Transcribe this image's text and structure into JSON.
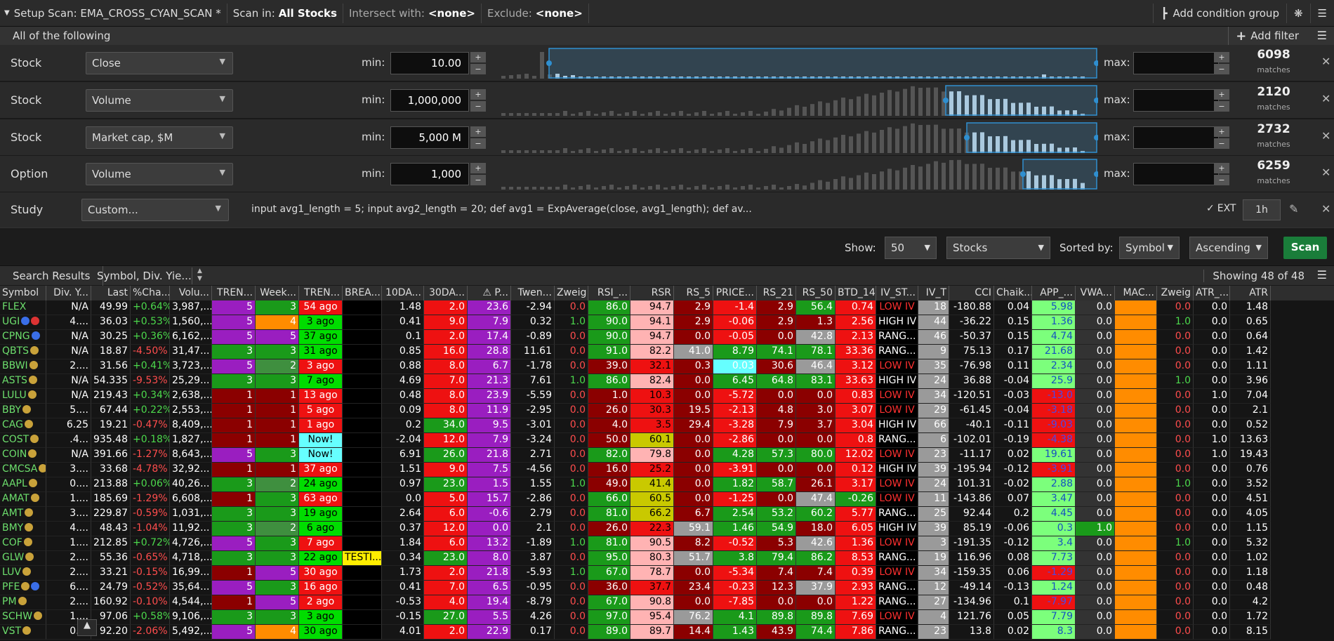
{
  "topbar": {
    "setup_scan": "Setup Scan: EMA_CROSS_CYAN_SCAN *",
    "scan_in_label": "Scan in:",
    "scan_in_value": "All Stocks",
    "intersect_label": "Intersect with:",
    "intersect_value": "<none>",
    "exclude_label": "Exclude:",
    "exclude_value": "<none>",
    "add_condition_group": "Add condition group"
  },
  "criteria": {
    "title": "All of the following",
    "add_filter": "Add filter"
  },
  "filters": [
    {
      "label": "Stock",
      "field": "Close",
      "min_label": "min:",
      "min": "10.00",
      "max_label": "max:",
      "max": "",
      "matches": "6098",
      "matches_label": "matches"
    },
    {
      "label": "Stock",
      "field": "Volume",
      "min_label": "min:",
      "min": "1,000,000",
      "max_label": "max:",
      "max": "",
      "matches": "2120",
      "matches_label": "matches"
    },
    {
      "label": "Stock",
      "field": "Market cap, $M",
      "min_label": "min:",
      "min": "5,000 M",
      "max_label": "max:",
      "max": "",
      "matches": "2732",
      "matches_label": "matches"
    },
    {
      "label": "Option",
      "field": "Volume",
      "min_label": "min:",
      "min": "1,000",
      "max_label": "max:",
      "max": "",
      "matches": "6259",
      "matches_label": "matches"
    }
  ],
  "study": {
    "label": "Study",
    "field": "Custom...",
    "code": "input avg1_length = 5; input avg2_length = 20;  def avg1 = ExpAverage(close, avg1_length); def av...",
    "ext": "EXT",
    "timeframe": "1h"
  },
  "show": {
    "label": "Show:",
    "count": "50",
    "type": "Stocks",
    "sorted_label": "Sorted by:",
    "sorted_field": "Symbol",
    "order": "Ascending",
    "scan": "Scan"
  },
  "results": {
    "tab": "Search Results",
    "sort_cols": "Symbol, Div. Yie...",
    "showing": "Showing 48 of 48"
  },
  "colors": {
    "green": "#00dd00",
    "red": "#ee1111",
    "purple": "#9a1ec0",
    "darkred": "#8b0000",
    "cyan": "#66ffff",
    "orange": "#ff8c00",
    "yellow": "#ffee00",
    "grey": "#9a9a9a",
    "pink": "#ffb3b3",
    "lime": "#7cff7c"
  },
  "table": {
    "headers": [
      "Symbol",
      "Div. Y...",
      "Last",
      "%Cha...",
      "Volu...",
      "TREN...",
      "Week...",
      "TREN...",
      "BREA...",
      "10DA...",
      "30DA...",
      "⚠ P...",
      "Twen...",
      "Zweig",
      "RSI_...",
      "RSR",
      "RS_5",
      "PRICE...",
      "RS_21",
      "RS_50",
      "BTD_14",
      "IV_ST...",
      "IV_T",
      "CCI",
      "Chaik...",
      "APP_...",
      "VWA...",
      "MAC...",
      "Zweig",
      "ATR_...",
      "ATR"
    ],
    "rows": [
      [
        "FLEX",
        "N/A",
        "49.99",
        "+0.64%",
        "3,987,...",
        "5",
        "3",
        "54 ago",
        "",
        "1.48",
        "2.0",
        "23.6",
        "-2.94",
        "0.0",
        "86.0",
        "94.7",
        "2.9",
        "-1.4",
        "2.9",
        "56.4",
        "0.74",
        "LOW IV",
        "18",
        "-180.88",
        "0.04",
        "5.98",
        "0.0",
        "",
        "0.0",
        "0.0",
        "1.48"
      ],
      [
        "UGI",
        "4....",
        "36.03",
        "+0.53%",
        "1,560,...",
        "5",
        "4",
        "3 ago",
        "",
        "0.41",
        "9.0",
        "7.9",
        "0.32",
        "1.0",
        "90.0",
        "94.1",
        "2.9",
        "-0.06",
        "2.9",
        "1.3",
        "2.56",
        "HIGH IV",
        "44",
        "-36.22",
        "0.15",
        "1.36",
        "0.0",
        "",
        "1.0",
        "0.0",
        "0.65"
      ],
      [
        "CPNG",
        "N/A",
        "30.25",
        "+0.36%",
        "6,162,...",
        "5",
        "5",
        "37 ago",
        "",
        "0.1",
        "2.0",
        "17.4",
        "-0.89",
        "0.0",
        "90.0",
        "94.7",
        "0.0",
        "-0.05",
        "0.0",
        "42.8",
        "2.13",
        "RANG...",
        "46",
        "-50.37",
        "0.15",
        "4.74",
        "0.0",
        "",
        "0.0",
        "0.0",
        "0.64"
      ],
      [
        "QBTS",
        "N/A",
        "18.87",
        "-4.50%",
        "31,47...",
        "3",
        "3",
        "31 ago",
        "",
        "0.85",
        "16.0",
        "28.8",
        "11.61",
        "0.0",
        "91.0",
        "82.2",
        "41.0",
        "8.79",
        "74.1",
        "78.1",
        "33.36",
        "RANG...",
        "9",
        "75.13",
        "0.17",
        "21.68",
        "0.0",
        "",
        "0.0",
        "0.0",
        "1.42"
      ],
      [
        "BBWI",
        "2....",
        "31.56",
        "+0.41%",
        "3,723,...",
        "5",
        "2",
        "3 ago",
        "",
        "0.88",
        "8.0",
        "6.7",
        "-1.78",
        "0.0",
        "39.0",
        "32.1",
        "0.3",
        "0.03",
        "30.6",
        "46.4",
        "3.12",
        "LOW IV",
        "35",
        "-76.98",
        "0.11",
        "2.34",
        "0.0",
        "",
        "0.0",
        "0.0",
        "1.11"
      ],
      [
        "ASTS",
        "N/A",
        "54.335",
        "-9.53%",
        "25,29...",
        "3",
        "3",
        "7 ago",
        "",
        "4.69",
        "7.0",
        "21.3",
        "7.61",
        "1.0",
        "86.0",
        "82.4",
        "0.0",
        "6.45",
        "64.8",
        "83.1",
        "33.63",
        "HIGH IV",
        "24",
        "36.88",
        "-0.04",
        "25.9",
        "0.0",
        "",
        "1.0",
        "0.0",
        "3.96"
      ],
      [
        "LULU",
        "N/A",
        "219.43",
        "+0.34%",
        "2,638,...",
        "1",
        "1",
        "13 ago",
        "",
        "0.48",
        "8.0",
        "23.9",
        "-5.59",
        "0.0",
        "1.0",
        "10.3",
        "0.0",
        "-5.72",
        "0.0",
        "0.0",
        "0.83",
        "LOW IV",
        "34",
        "-120.51",
        "-0.03",
        "-13.0",
        "0.0",
        "",
        "0.0",
        "1.0",
        "7.04"
      ],
      [
        "BBY",
        "5....",
        "67.44",
        "+0.22%",
        "2,553,...",
        "1",
        "1",
        "5 ago",
        "",
        "0.09",
        "8.0",
        "11.9",
        "-2.95",
        "0.0",
        "26.0",
        "30.3",
        "19.5",
        "-2.13",
        "4.8",
        "3.0",
        "3.07",
        "LOW IV",
        "29",
        "-61.45",
        "-0.04",
        "-3.18",
        "0.0",
        "",
        "0.0",
        "0.0",
        "2.1"
      ],
      [
        "CAG",
        "6.25",
        "19.21",
        "-0.47%",
        "8,409,...",
        "1",
        "1",
        "1 ago",
        "",
        "0.2",
        "34.0",
        "9.5",
        "-3.01",
        "0.0",
        "4.0",
        "3.5",
        "29.4",
        "-3.28",
        "7.9",
        "3.7",
        "3.04",
        "HIGH IV",
        "66",
        "-40.1",
        "-0.11",
        "-9.03",
        "0.0",
        "",
        "0.0",
        "0.0",
        "0.52"
      ],
      [
        "COST",
        ".4...",
        "935.48",
        "+0.18%",
        "1,827,...",
        "1",
        "1",
        "Now!",
        "",
        "-2.04",
        "12.0",
        "7.9",
        "-3.24",
        "0.0",
        "50.0",
        "60.1",
        "0.0",
        "-2.86",
        "0.0",
        "0.0",
        "0.8",
        "RANG...",
        "6",
        "-102.01",
        "-0.19",
        "-4.38",
        "0.0",
        "",
        "0.0",
        "1.0",
        "13.63"
      ],
      [
        "COIN",
        "N/A",
        "391.66",
        "-1.27%",
        "8,643,...",
        "5",
        "3",
        "Now!",
        "",
        "6.91",
        "26.0",
        "21.8",
        "2.71",
        "0.0",
        "82.0",
        "79.8",
        "0.0",
        "4.28",
        "57.3",
        "80.0",
        "12.02",
        "LOW IV",
        "23",
        "-11.17",
        "0.02",
        "19.61",
        "0.0",
        "",
        "0.0",
        "1.0",
        "19.43"
      ],
      [
        "CMCSA",
        "3....",
        "33.68",
        "-4.78%",
        "32,92...",
        "1",
        "1",
        "37 ago",
        "",
        "1.51",
        "9.0",
        "7.5",
        "-4.56",
        "0.0",
        "16.0",
        "25.2",
        "0.0",
        "-3.91",
        "0.0",
        "0.0",
        "0.12",
        "HIGH IV",
        "39",
        "-195.94",
        "-0.12",
        "-3.91",
        "0.0",
        "",
        "0.0",
        "0.0",
        "0.76"
      ],
      [
        "AAPL",
        "0....",
        "213.88",
        "+0.06%",
        "40,26...",
        "3",
        "2",
        "24 ago",
        "",
        "0.97",
        "23.0",
        "1.5",
        "1.55",
        "1.0",
        "49.0",
        "41.4",
        "0.0",
        "1.82",
        "58.7",
        "26.1",
        "3.17",
        "LOW IV",
        "24",
        "101.31",
        "-0.02",
        "2.88",
        "0.0",
        "",
        "1.0",
        "0.0",
        "3.52"
      ],
      [
        "AMAT",
        "1....",
        "185.69",
        "-1.29%",
        "6,608,...",
        "1",
        "3",
        "63 ago",
        "",
        "0.0",
        "5.0",
        "15.7",
        "-2.86",
        "0.0",
        "66.0",
        "60.5",
        "0.0",
        "-1.25",
        "0.0",
        "47.4",
        "-0.26",
        "LOW IV",
        "11",
        "-143.86",
        "0.07",
        "3.47",
        "0.0",
        "",
        "0.0",
        "0.0",
        "4.51"
      ],
      [
        "AMT",
        "3....",
        "229.87",
        "-0.59%",
        "1,031,...",
        "3",
        "3",
        "19 ago",
        "",
        "2.64",
        "6.0",
        "-0.6",
        "2.79",
        "0.0",
        "81.0",
        "66.2",
        "6.7",
        "2.54",
        "53.2",
        "60.2",
        "5.77",
        "RANG...",
        "25",
        "92.44",
        "0.2",
        "4.45",
        "0.0",
        "",
        "0.0",
        "0.0",
        "4.05"
      ],
      [
        "BMY",
        "4....",
        "48.43",
        "-1.04%",
        "11,92...",
        "3",
        "2",
        "6 ago",
        "",
        "0.37",
        "12.0",
        "0.0",
        "2.1",
        "0.0",
        "26.0",
        "22.3",
        "59.1",
        "1.46",
        "54.9",
        "18.0",
        "6.05",
        "HIGH IV",
        "39",
        "85.19",
        "-0.06",
        "0.3",
        "1.0",
        "",
        "0.0",
        "0.0",
        "1.15"
      ],
      [
        "COF",
        "1....",
        "212.85",
        "+0.72%",
        "4,726,...",
        "5",
        "3",
        "7 ago",
        "",
        "1.84",
        "6.0",
        "13.2",
        "-1.89",
        "1.0",
        "81.0",
        "90.5",
        "8.2",
        "-0.52",
        "5.3",
        "42.6",
        "1.36",
        "LOW IV",
        "3",
        "-191.35",
        "-0.12",
        "3.4",
        "0.0",
        "",
        "1.0",
        "0.0",
        "5.32"
      ],
      [
        "GLW",
        "2....",
        "55.36",
        "-0.65%",
        "4,718,...",
        "3",
        "3",
        "22 ago",
        "TESTI...",
        "0.34",
        "23.0",
        "8.0",
        "3.87",
        "0.0",
        "95.0",
        "80.3",
        "51.7",
        "3.8",
        "79.4",
        "86.2",
        "8.53",
        "RANG...",
        "19",
        "116.96",
        "0.08",
        "7.73",
        "0.0",
        "",
        "0.0",
        "0.0",
        "1.02"
      ],
      [
        "LUV",
        "2....",
        "33.21",
        "-0.15%",
        "16,99...",
        "1",
        "5",
        "30 ago",
        "",
        "1.73",
        "2.0",
        "21.8",
        "-5.93",
        "1.0",
        "67.0",
        "78.7",
        "0.0",
        "-5.34",
        "7.4",
        "7.4",
        "0.39",
        "LOW IV",
        "34",
        "-159.35",
        "0.06",
        "-1.29",
        "0.0",
        "",
        "0.0",
        "0.0",
        "1.18"
      ],
      [
        "PFE",
        "6....",
        "24.79",
        "-0.52%",
        "35,64...",
        "5",
        "3",
        "16 ago",
        "",
        "0.41",
        "7.0",
        "6.5",
        "-0.95",
        "0.0",
        "36.0",
        "37.7",
        "23.4",
        "-0.23",
        "12.3",
        "37.9",
        "2.93",
        "RANG...",
        "12",
        "-49.14",
        "-0.13",
        "1.24",
        "0.0",
        "",
        "0.0",
        "0.0",
        "0.48"
      ],
      [
        "PM",
        "2....",
        "160.92",
        "-0.10%",
        "4,544,...",
        "1",
        "5",
        "2 ago",
        "",
        "-0.53",
        "4.0",
        "19.4",
        "-8.79",
        "0.0",
        "67.0",
        "90.8",
        "0.0",
        "-7.85",
        "0.0",
        "0.0",
        "1.22",
        "RANG...",
        "27",
        "-134.96",
        "0.1",
        "-7.97",
        "0.0",
        "",
        "0.0",
        "0.0",
        "4.2"
      ],
      [
        "SCHW",
        "1....",
        "97.06",
        "+0.58%",
        "9,106,...",
        "3",
        "3",
        "3 ago",
        "",
        "-0.15",
        "27.0",
        "5.5",
        "4.26",
        "0.0",
        "97.0",
        "95.4",
        "76.2",
        "4.1",
        "89.8",
        "89.8",
        "7.69",
        "LOW IV",
        "4",
        "121.76",
        "0.05",
        "7.79",
        "0.0",
        "",
        "0.0",
        "0.0",
        "1.72"
      ],
      [
        "VST",
        "0....",
        "92.20",
        "-2.06%",
        "5,492,...",
        "5",
        "4",
        "30 ago",
        "",
        "4.01",
        "2.0",
        "22.9",
        "0.17",
        "0.0",
        "89.0",
        "89.7",
        "14.4",
        "1.43",
        "43.9",
        "74.4",
        "7.86",
        "RANG...",
        "23",
        "13.8",
        "0.02",
        "8.3",
        "0.0",
        "",
        "0.0",
        "0.0",
        "8.15"
      ]
    ],
    "icons": {
      "UGI": [
        "blue-icon",
        "red-icon"
      ],
      "CPNG": [
        "blue-icon"
      ],
      "QBTS": [
        "orange-icon"
      ],
      "BBWI": [
        "orange-icon"
      ],
      "ASTS": [
        "orange-icon"
      ],
      "LULU": [
        "orange-icon"
      ],
      "BBY": [
        "orange-icon"
      ],
      "CAG": [
        "orange-icon"
      ],
      "COST": [
        "orange-icon"
      ],
      "COIN": [
        "orange-icon"
      ],
      "CMCSA": [
        "orange-icon"
      ],
      "AAPL": [
        "orange-icon"
      ],
      "AMAT": [
        "orange-icon"
      ],
      "AMT": [
        "orange-icon"
      ],
      "BMY": [
        "orange-icon"
      ],
      "COF": [
        "orange-icon"
      ],
      "GLW": [
        "orange-icon"
      ],
      "LUV": [
        "orange-icon"
      ],
      "PFE": [
        "orange-icon",
        "blue-icon"
      ],
      "PM": [
        "orange-icon"
      ],
      "SCHW": [
        "orange-icon"
      ],
      "VST": [
        "orange-icon"
      ]
    }
  }
}
